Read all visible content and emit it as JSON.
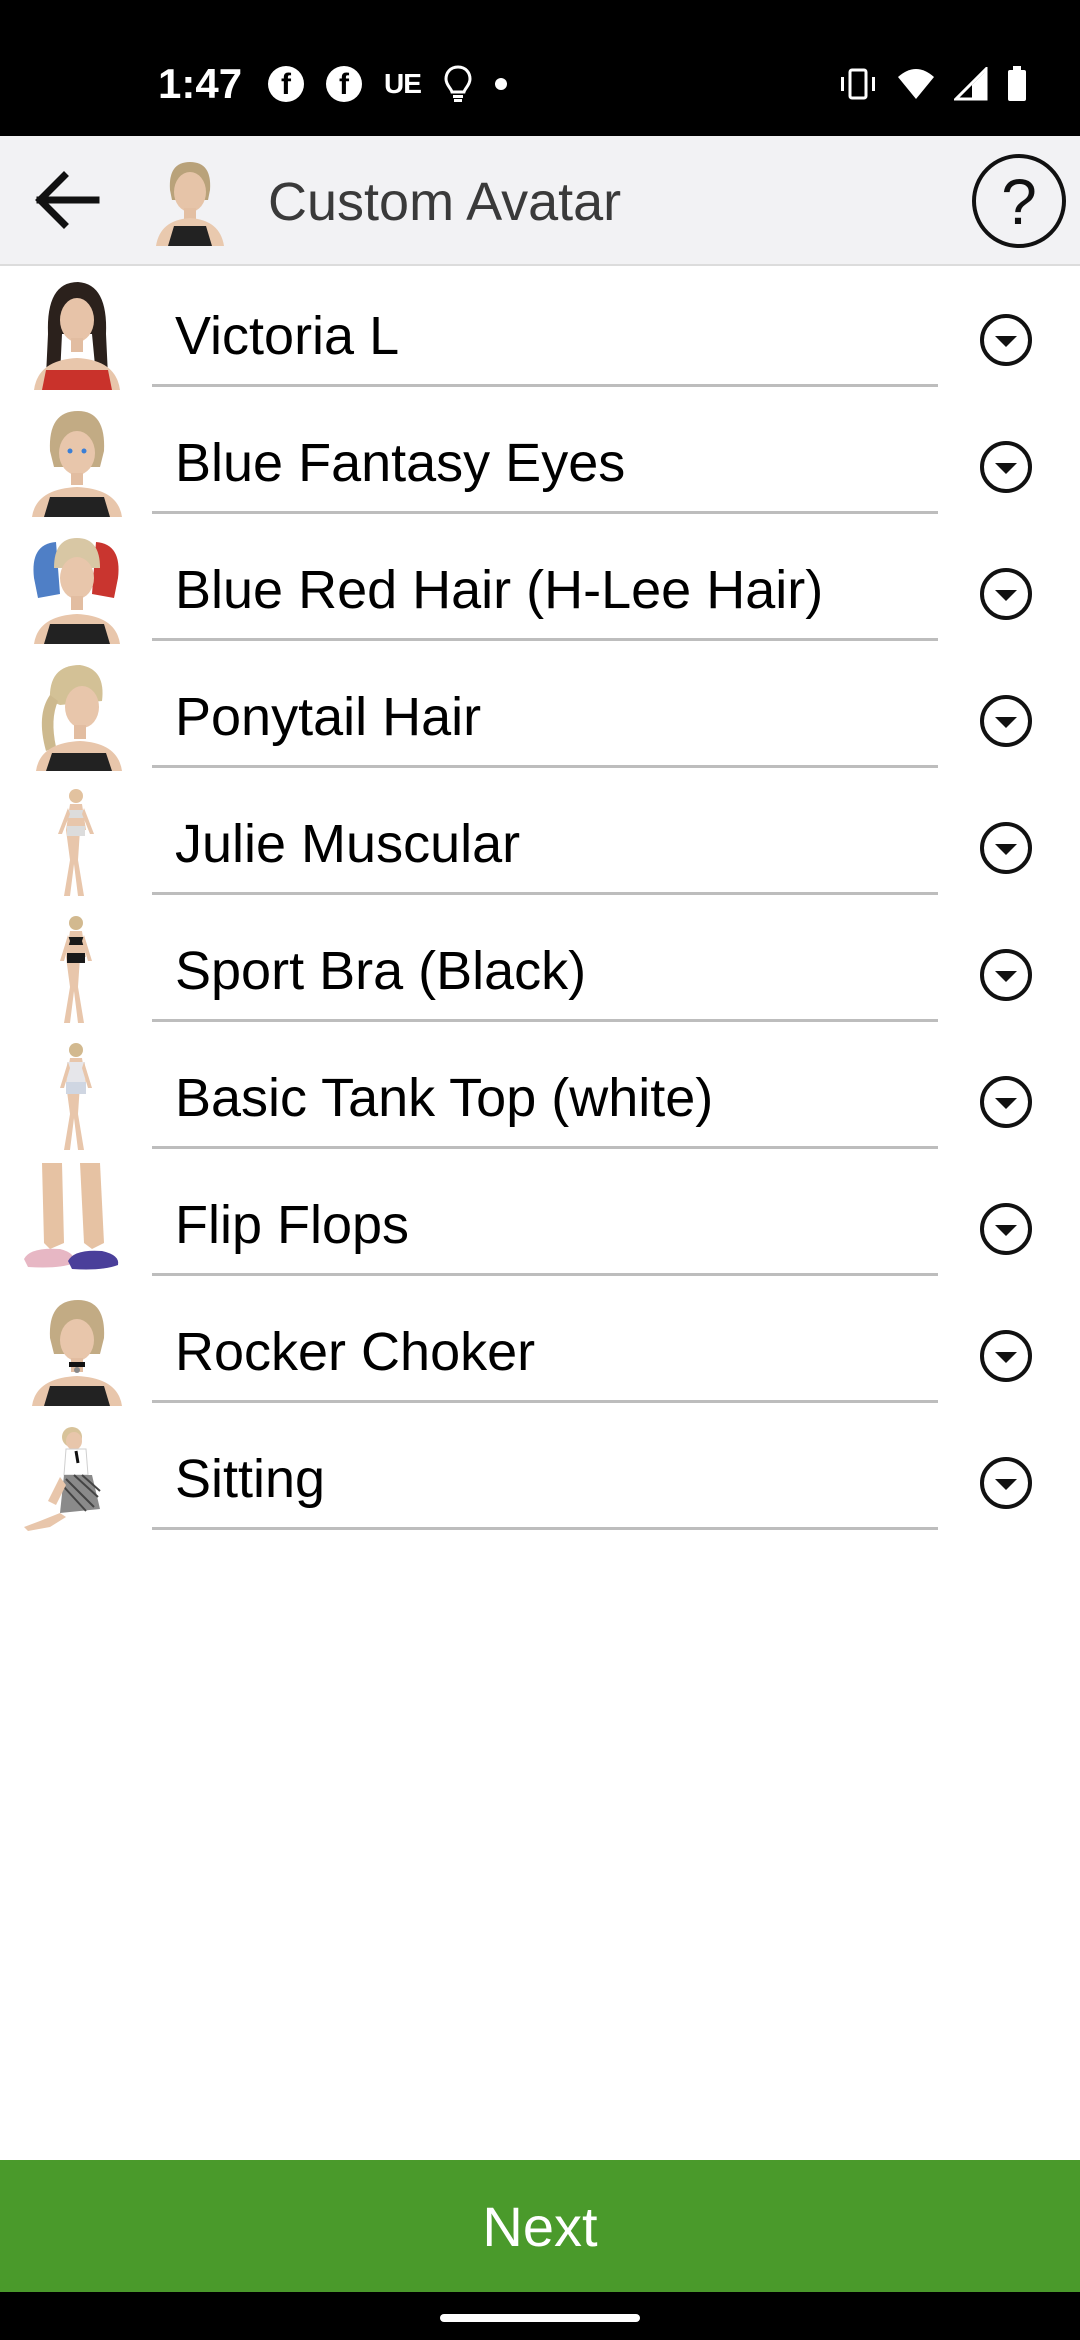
{
  "status_bar": {
    "time": "1:47",
    "left_icons": [
      "facebook-icon",
      "facebook-icon",
      "ue-icon",
      "lightbulb-icon",
      "dot-icon"
    ],
    "ue_label": "UE",
    "right_icons": [
      "vibrate-icon",
      "wifi-icon",
      "cell-signal-icon",
      "battery-icon"
    ]
  },
  "app_bar": {
    "title": "Custom Avatar",
    "back_icon": "arrow-left-icon",
    "help_label": "?"
  },
  "items": [
    {
      "label": "Victoria L",
      "thumb": "woman-dark-hair-portrait"
    },
    {
      "label": "Blue Fantasy Eyes",
      "thumb": "woman-blonde-portrait"
    },
    {
      "label": "Blue Red Hair (H-Lee Hair)",
      "thumb": "woman-blue-red-pigtails"
    },
    {
      "label": "Ponytail Hair",
      "thumb": "woman-ponytail-profile"
    },
    {
      "label": "Julie Muscular",
      "thumb": "full-body-figure"
    },
    {
      "label": "Sport Bra (Black)",
      "thumb": "full-body-figure-black"
    },
    {
      "label": "Basic Tank Top (white)",
      "thumb": "full-body-figure-white"
    },
    {
      "label": "Flip Flops",
      "thumb": "feet-flip-flops"
    },
    {
      "label": "Rocker Choker",
      "thumb": "woman-choker-portrait"
    },
    {
      "label": "Sitting",
      "thumb": "sitting-figure"
    }
  ],
  "next_button": {
    "label": "Next"
  },
  "colors": {
    "accent_green": "#4a9a2b",
    "app_bar_bg": "#f2f2f4",
    "status_bar_bg": "#000000"
  }
}
